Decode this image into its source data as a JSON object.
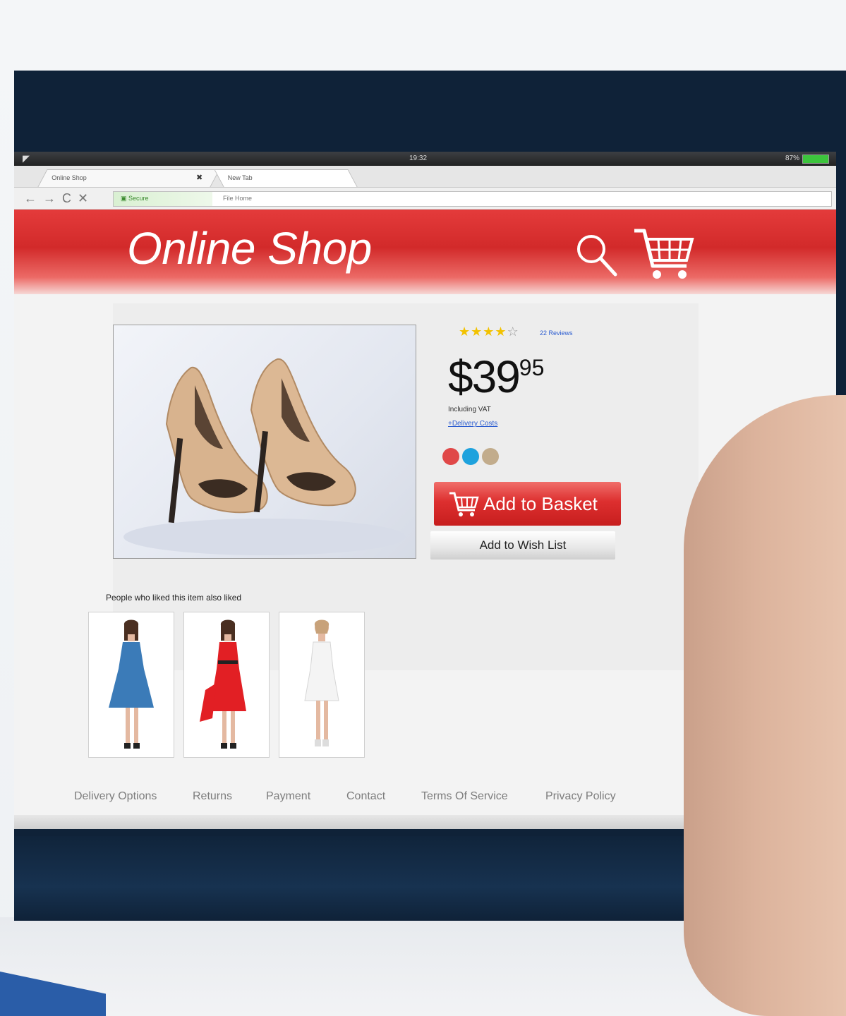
{
  "statusbar": {
    "time": "19:32",
    "battery_pct": "87%"
  },
  "browser": {
    "tabs": [
      {
        "label": "Online Shop"
      },
      {
        "label": "New Tab"
      }
    ],
    "nav_buttons": "← → C ✕",
    "url_secure_label": "Secure",
    "url_text": "File Home"
  },
  "header": {
    "title": "Online Shop"
  },
  "product": {
    "rating": 4,
    "rating_max": 5,
    "reviews": "22 Reviews",
    "price_main": "$39",
    "price_cents": "95",
    "vat_note": "Including VAT",
    "delivery_link": "+Delivery Costs",
    "colors": [
      "#e04848",
      "#1ea2dd",
      "#c2ac8c"
    ],
    "add_basket": "Add to Basket",
    "wish_list": "Add to Wish List"
  },
  "also_liked": {
    "title": "People who liked this item also liked",
    "items": [
      {
        "dress_color": "#3b7bb8"
      },
      {
        "dress_color": "#e21f24"
      },
      {
        "dress_color": "#f4f4f4"
      }
    ]
  },
  "footer": {
    "links": [
      "Delivery Options",
      "Returns",
      "Payment",
      "Contact",
      "Terms Of Service",
      "Privacy Policy"
    ]
  },
  "colors": {
    "brand_red": "#d92b2b",
    "screen_bg": "#f3f3f3",
    "device_frame": "#0f2238"
  }
}
